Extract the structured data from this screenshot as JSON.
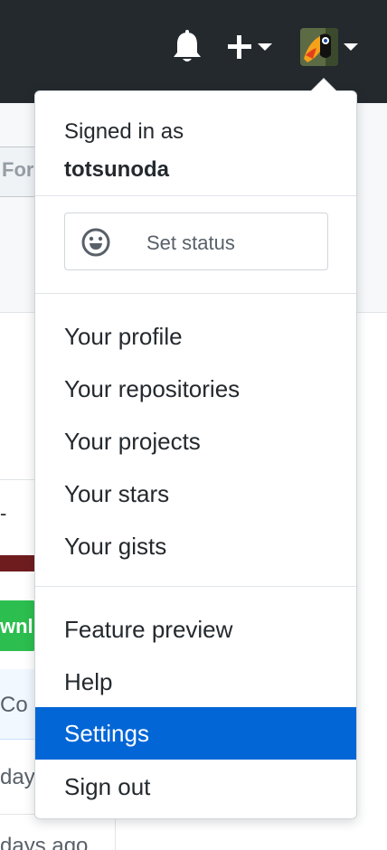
{
  "header": {
    "notifications_icon": "bell-icon",
    "create_icon": "plus-icon",
    "avatar_alt": "toucan avatar"
  },
  "background": {
    "fork_fragment": "For",
    "dash_fragment": "-",
    "download_fragment": "wnl",
    "commit_fragment": "Co",
    "days_fragment_1": "day",
    "days_fragment_2": "days ago"
  },
  "menu": {
    "signed_in_prefix": "Signed in as",
    "username": "totsunoda",
    "status_button": "Set status",
    "status_icon": "smiley-icon",
    "section1": [
      "Your profile",
      "Your repositories",
      "Your projects",
      "Your stars",
      "Your gists"
    ],
    "section2": [
      "Feature preview",
      "Help",
      "Settings",
      "Sign out"
    ],
    "active_item": "Settings",
    "colors": {
      "active": "#0366d6",
      "header": "#24292e"
    }
  }
}
